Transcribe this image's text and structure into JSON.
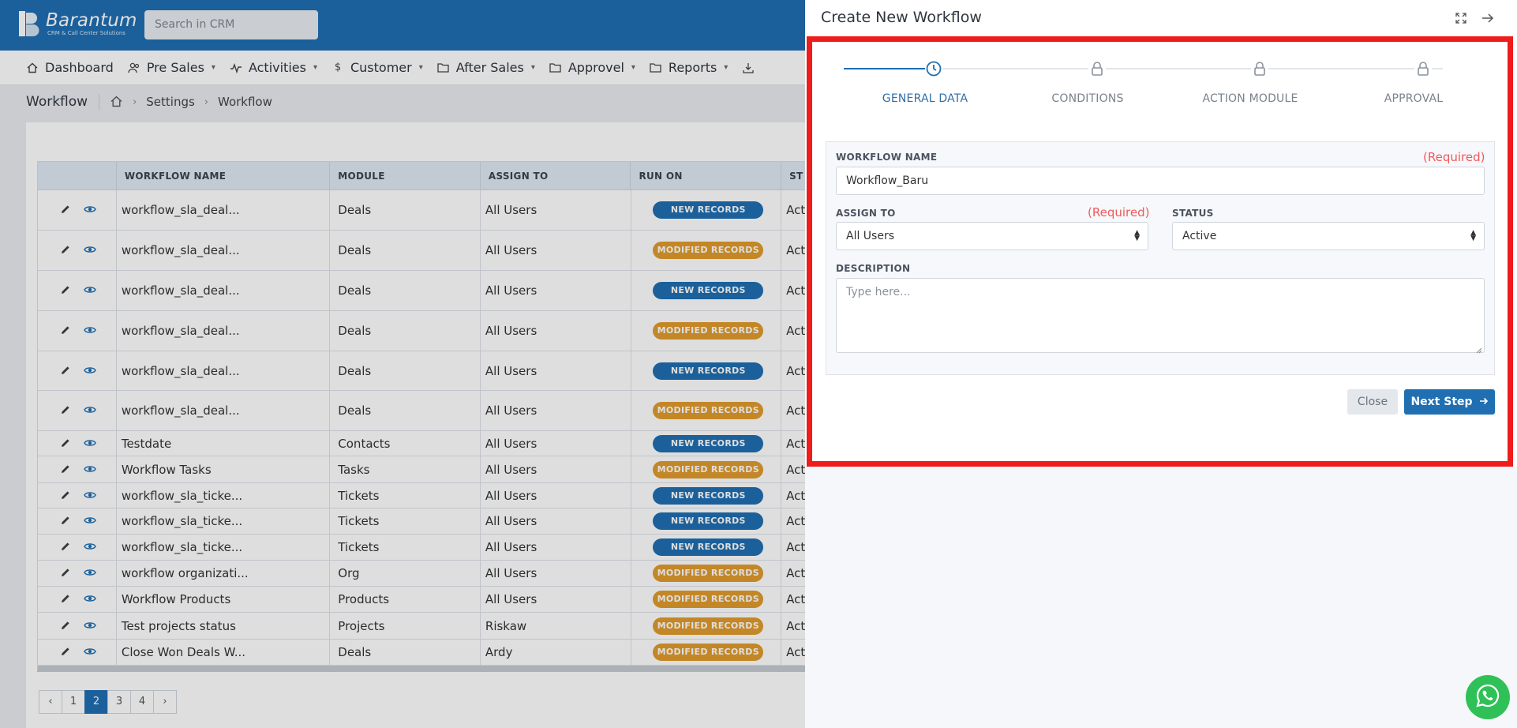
{
  "header": {
    "brand_name": "Barantum",
    "brand_tagline": "CRM & Call Center Solutions",
    "search_placeholder": "Search in CRM"
  },
  "nav": {
    "items": [
      {
        "label": "Dashboard",
        "icon": "home-icon"
      },
      {
        "label": "Pre Sales",
        "icon": "users-icon"
      },
      {
        "label": "Activities",
        "icon": "activity-icon"
      },
      {
        "label": "Customer",
        "icon": "dollar-icon"
      },
      {
        "label": "After Sales",
        "icon": "folder-icon"
      },
      {
        "label": "Approvel",
        "icon": "folder-icon"
      },
      {
        "label": "Reports",
        "icon": "folder-icon"
      }
    ]
  },
  "breadcrumb": {
    "title": "Workflow",
    "items": [
      "Settings",
      "Workflow"
    ]
  },
  "table": {
    "columns": [
      "WORKFLOW NAME",
      "MODULE",
      "ASSIGN TO",
      "RUN ON",
      "ST"
    ],
    "rows": [
      {
        "name": "workflow_sla_deal...",
        "module": "Deals",
        "assign": "All Users",
        "run_on": "NEW RECORDS",
        "run_type": "new",
        "status": "Act"
      },
      {
        "name": "workflow_sla_deal...",
        "module": "Deals",
        "assign": "All Users",
        "run_on": "MODIFIED RECORDS",
        "run_type": "mod",
        "status": "Act"
      },
      {
        "name": "workflow_sla_deal...",
        "module": "Deals",
        "assign": "All Users",
        "run_on": "NEW RECORDS",
        "run_type": "new",
        "status": "Act"
      },
      {
        "name": "workflow_sla_deal...",
        "module": "Deals",
        "assign": "All Users",
        "run_on": "MODIFIED RECORDS",
        "run_type": "mod",
        "status": "Act"
      },
      {
        "name": "workflow_sla_deal...",
        "module": "Deals",
        "assign": "All Users",
        "run_on": "NEW RECORDS",
        "run_type": "new",
        "status": "Act"
      },
      {
        "name": "workflow_sla_deal...",
        "module": "Deals",
        "assign": "All Users",
        "run_on": "MODIFIED RECORDS",
        "run_type": "mod",
        "status": "Act"
      },
      {
        "name": "Testdate",
        "module": "Contacts",
        "assign": "All Users",
        "run_on": "NEW RECORDS",
        "run_type": "new",
        "status": "Act"
      },
      {
        "name": "Workflow Tasks",
        "module": "Tasks",
        "assign": "All Users",
        "run_on": "MODIFIED RECORDS",
        "run_type": "mod",
        "status": "Act"
      },
      {
        "name": "workflow_sla_ticke...",
        "module": "Tickets",
        "assign": "All Users",
        "run_on": "NEW RECORDS",
        "run_type": "new",
        "status": "Act"
      },
      {
        "name": "workflow_sla_ticke...",
        "module": "Tickets",
        "assign": "All Users",
        "run_on": "NEW RECORDS",
        "run_type": "new",
        "status": "Act"
      },
      {
        "name": "workflow_sla_ticke...",
        "module": "Tickets",
        "assign": "All Users",
        "run_on": "NEW RECORDS",
        "run_type": "new",
        "status": "Act"
      },
      {
        "name": "workflow organizati...",
        "module": "Org",
        "assign": "All Users",
        "run_on": "MODIFIED RECORDS",
        "run_type": "mod",
        "status": "Act"
      },
      {
        "name": "Workflow Products",
        "module": "Products",
        "assign": "All Users",
        "run_on": "MODIFIED RECORDS",
        "run_type": "mod",
        "status": "Act"
      },
      {
        "name": "Test projects status",
        "module": "Projects",
        "assign": "Riskaw",
        "run_on": "MODIFIED RECORDS",
        "run_type": "mod",
        "status": "Act"
      },
      {
        "name": "Close Won Deals W...",
        "module": "Deals",
        "assign": "Ardy",
        "run_on": "MODIFIED RECORDS",
        "run_type": "mod",
        "status": "Act"
      }
    ]
  },
  "pagination": {
    "prev": "‹",
    "pages": [
      "1",
      "2",
      "3",
      "4"
    ],
    "active_page": "2",
    "next": "›",
    "first": "‹"
  },
  "panel": {
    "title": "Create New Workflow",
    "steps": [
      {
        "label": "GENERAL DATA",
        "state": "active",
        "icon": "clock-icon"
      },
      {
        "label": "CONDITIONS",
        "state": "locked",
        "icon": "lock-icon"
      },
      {
        "label": "ACTION MODULE",
        "state": "locked",
        "icon": "lock-icon"
      },
      {
        "label": "APPROVAL",
        "state": "locked",
        "icon": "lock-icon"
      }
    ],
    "form": {
      "workflow_name_label": "WORKFLOW NAME",
      "workflow_name_required": "(Required)",
      "workflow_name_value": "Workflow_Baru",
      "assign_to_label": "ASSIGN TO",
      "assign_to_required": "(Required)",
      "assign_to_value": "All Users",
      "status_label": "STATUS",
      "status_value": "Active",
      "description_label": "DESCRIPTION",
      "description_placeholder": "Type here..."
    },
    "close_label": "Close",
    "next_label": "Next Step"
  },
  "colors": {
    "primary": "#1f6fb2",
    "modified_badge": "#e09b2d",
    "required": "#ef5a5a",
    "highlight_frame": "#ef1c1c",
    "whatsapp": "#2fc157"
  }
}
